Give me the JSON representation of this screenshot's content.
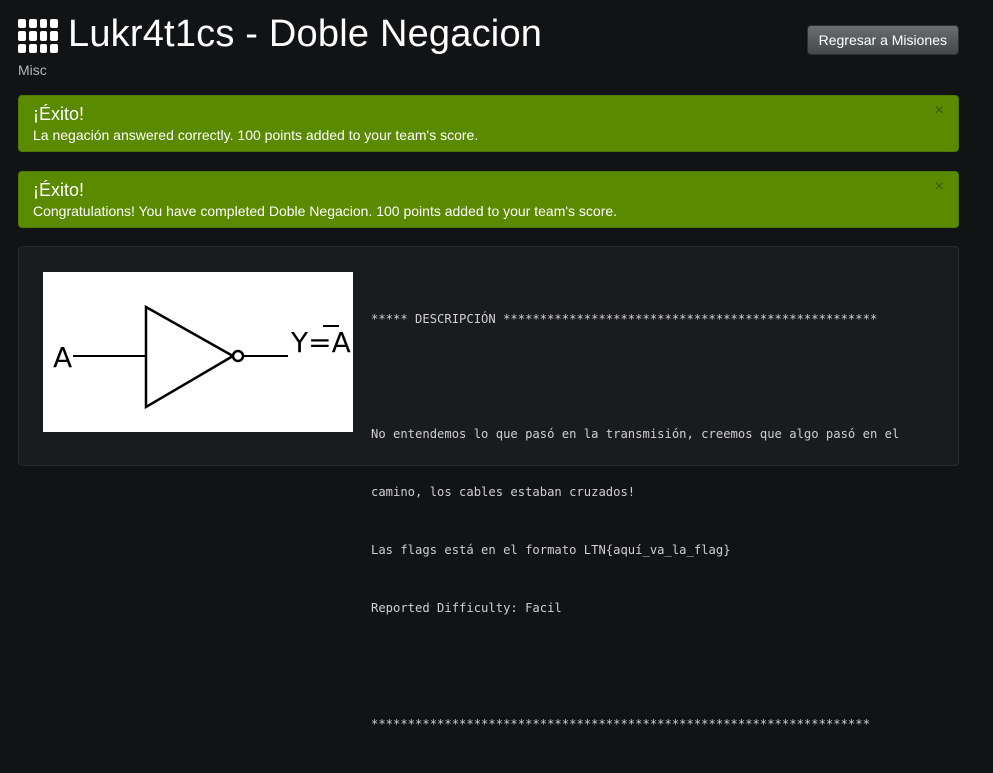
{
  "header": {
    "title": "Lukr4t1cs - Doble Negacion",
    "category": "Misc",
    "back_button_label": "Regresar a Misiones",
    "icon": "grid-icon"
  },
  "alerts": [
    {
      "heading": "¡Éxito!",
      "text": "La negación answered correctly. 100 points added to your team's score.",
      "close": "×"
    },
    {
      "heading": "¡Éxito!",
      "text": "Congratulations! You have completed Doble Negacion. 100 points added to your team's score.",
      "close": "×"
    }
  ],
  "diagram": {
    "input_label": "A",
    "output_label": "Y=A",
    "overline_on": "A"
  },
  "description": {
    "header_line": "***** DESCRIPCIÓN ***************************************************",
    "line1": "No entendemos lo que pasó en la transmisión, creemos que algo pasó en el",
    "line2": "camino, los cables estaban cruzados!",
    "line3": "Las flags está en el formato LTN{aquí_va_la_flag}",
    "line4": "Reported Difficulty: Facil",
    "footer_line": "********************************************************************"
  },
  "colors": {
    "background": "#121315",
    "success": "#5a8a00",
    "button": "#56585b"
  }
}
